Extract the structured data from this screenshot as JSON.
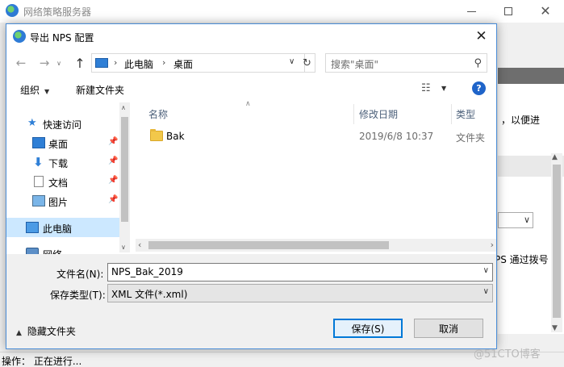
{
  "background_window": {
    "title": "网络策略服务器",
    "right_text_1": "，以便进",
    "right_text_2": "PS 通过拨号",
    "status_label": "操作：",
    "status_value": "正在进行..."
  },
  "watermark": "@51CTO博客",
  "dialog": {
    "title": "导出 NPS 配置",
    "close_glyph": "✕"
  },
  "nav": {
    "back_glyph": "←",
    "forward_glyph": "→",
    "recent_glyph": "∨",
    "up_glyph": "↑"
  },
  "address": {
    "crumbs": [
      "此电脑",
      "桌面"
    ],
    "separator": "›"
  },
  "search": {
    "placeholder": "搜索\"桌面\""
  },
  "toolbar": {
    "organize_label": "组织",
    "new_folder_label": "新建文件夹",
    "help_glyph": "?"
  },
  "nav_pane": {
    "items": [
      {
        "label": "快速访问",
        "icon": "star-icon"
      },
      {
        "label": "桌面",
        "icon": "desktop-icon",
        "pinned": true
      },
      {
        "label": "下载",
        "icon": "download-icon",
        "pinned": true
      },
      {
        "label": "文档",
        "icon": "document-icon",
        "pinned": true
      },
      {
        "label": "图片",
        "icon": "pictures-icon",
        "pinned": true
      },
      {
        "label": "此电脑",
        "icon": "computer-icon",
        "selected": true
      },
      {
        "label": "网络",
        "icon": "network-icon"
      }
    ]
  },
  "file_list": {
    "columns": [
      "名称",
      "修改日期",
      "类型"
    ],
    "rows": [
      {
        "name": "Bak",
        "modified": "2019/6/8 10:37",
        "type": "文件夹"
      }
    ]
  },
  "form": {
    "filename_label": "文件名(N):",
    "filename_value": "NPS_Bak_2019",
    "filetype_label": "保存类型(T):",
    "filetype_value": "XML 文件(*.xml)"
  },
  "footer": {
    "hide_folders_label": "隐藏文件夹",
    "save_label": "保存(S)",
    "cancel_label": "取消"
  },
  "colors": {
    "accent": "#0078d7",
    "selection": "#cce8ff",
    "dialog_border": "#4a8dd8"
  }
}
